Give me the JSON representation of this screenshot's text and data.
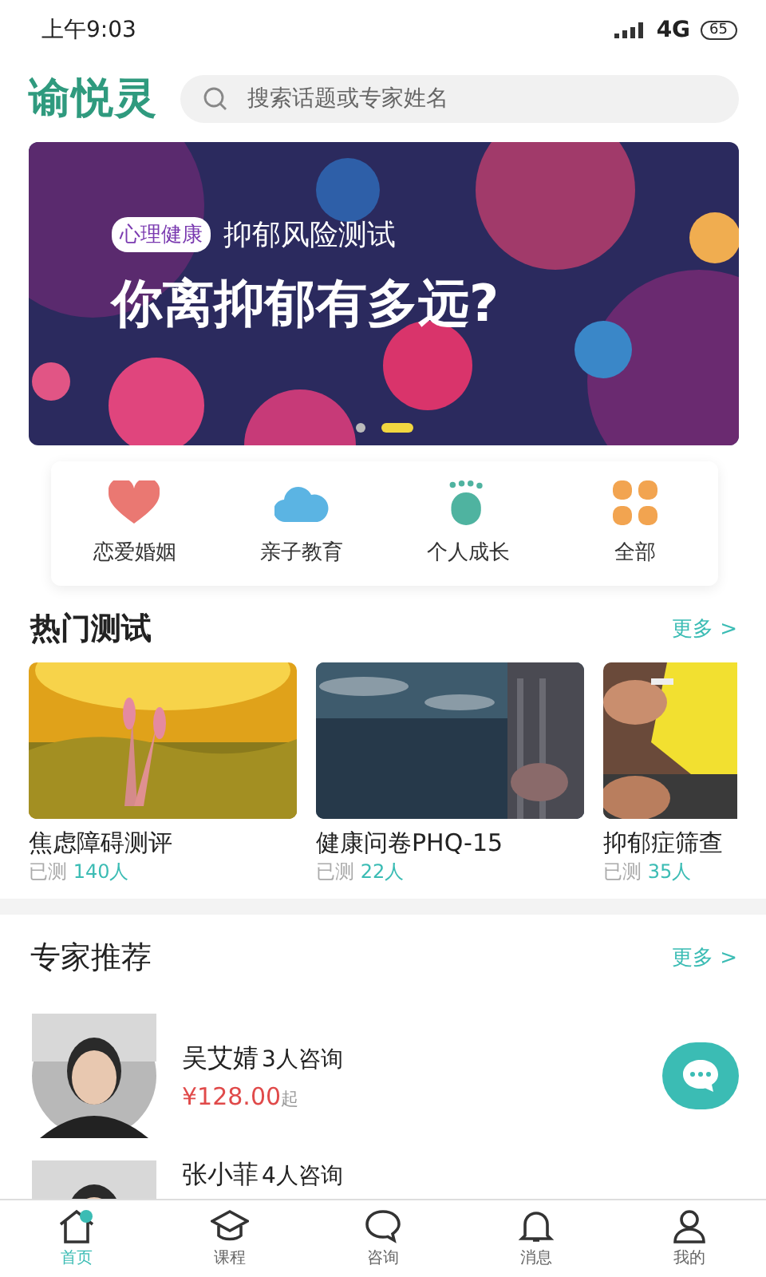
{
  "status_bar": {
    "time": "上午9:03",
    "network": "4G",
    "battery": "65"
  },
  "header": {
    "logo": "谕悦灵",
    "search": {
      "placeholder": "搜索话题或专家姓名"
    }
  },
  "banner": {
    "badge": "心理健康",
    "subtitle": "抑郁风险测试",
    "title": "你离抑郁有多远?",
    "dots": [
      {
        "selected": false
      },
      {
        "selected": true
      }
    ]
  },
  "categories": [
    {
      "label": "恋爱婚姻",
      "kind": "heart"
    },
    {
      "label": "亲子教育",
      "kind": "cloud"
    },
    {
      "label": "个人成长",
      "kind": "foot"
    },
    {
      "label": "全部",
      "kind": "grid"
    }
  ],
  "hot_tests": {
    "title": "热门测试",
    "more": "更多 >",
    "items": [
      {
        "title": "焦虑障碍测评",
        "prefix": "已测",
        "count": "140人"
      },
      {
        "title": "健康问卷PHQ-15",
        "prefix": "已测",
        "count": "22人",
        "kind": "sea"
      },
      {
        "title": "抑郁症筛查",
        "prefix": "已测",
        "count": "35人",
        "kind": "paper"
      }
    ]
  },
  "experts": {
    "title": "专家推荐",
    "more": "更多 >",
    "items": [
      {
        "name": "吴艾婧",
        "consults": "3人咨询",
        "price": "¥128.00",
        "price_suffix": "起"
      },
      {
        "name": "张小菲",
        "consults": "4人咨询"
      }
    ]
  },
  "tab_bar": [
    {
      "label": "首页",
      "kind": "home",
      "selected": true
    },
    {
      "label": "课程",
      "kind": "cap",
      "selected": false
    },
    {
      "label": "咨询",
      "kind": "chat",
      "selected": false
    },
    {
      "label": "消息",
      "kind": "bell",
      "selected": false
    },
    {
      "label": "我的",
      "kind": "user",
      "selected": false
    }
  ]
}
